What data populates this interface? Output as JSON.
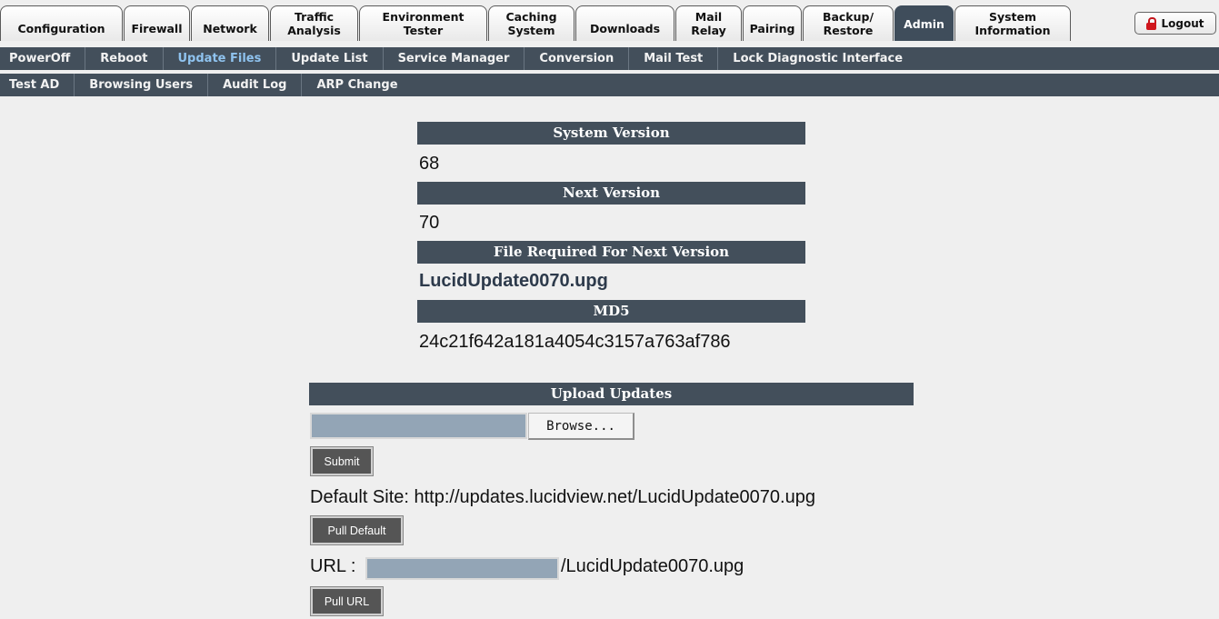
{
  "tabs": [
    {
      "label": "Configuration"
    },
    {
      "label": "Firewall"
    },
    {
      "label": "Network"
    },
    {
      "label": "Traffic Analysis"
    },
    {
      "label": "Environment Tester"
    },
    {
      "label": "Caching System"
    },
    {
      "label": "Downloads"
    },
    {
      "label": "Mail Relay"
    },
    {
      "label": "Pairing"
    },
    {
      "label": "Backup/ Restore"
    },
    {
      "label": "Admin"
    },
    {
      "label": "System Information"
    }
  ],
  "active_tab": "Admin",
  "logout_label": "Logout",
  "subnav1": [
    "PowerOff",
    "Reboot",
    "Update Files",
    "Update List",
    "Service Manager",
    "Conversion",
    "Mail Test",
    "Lock Diagnostic Interface"
  ],
  "subnav2": [
    "Test AD",
    "Browsing Users",
    "Audit Log",
    "ARP Change"
  ],
  "active_subnav": "Update Files",
  "info": {
    "system_version_label": "System Version",
    "system_version": "68",
    "next_version_label": "Next Version",
    "next_version": "70",
    "file_required_label": "File Required For Next Version",
    "file_required": "LucidUpdate0070.upg",
    "md5_label": "MD5",
    "md5": "24c21f642a181a4054c3157a763af786"
  },
  "upload": {
    "title": "Upload Updates",
    "browse_label": "Browse...",
    "submit_label": "Submit",
    "default_site_text": "Default Site: http://updates.lucidview.net/LucidUpdate0070.upg",
    "pull_default_label": "Pull Default",
    "url_label": "URL :",
    "url_value": "",
    "url_suffix": "/LucidUpdate0070.upg",
    "pull_url_label": "Pull URL"
  },
  "colors": {
    "header_bg": "#434f5b",
    "active_subnav": "#8fc3ef",
    "input_bg": "#93a5b6",
    "button_bg": "#555555",
    "logout_lock": "#d0161d"
  }
}
